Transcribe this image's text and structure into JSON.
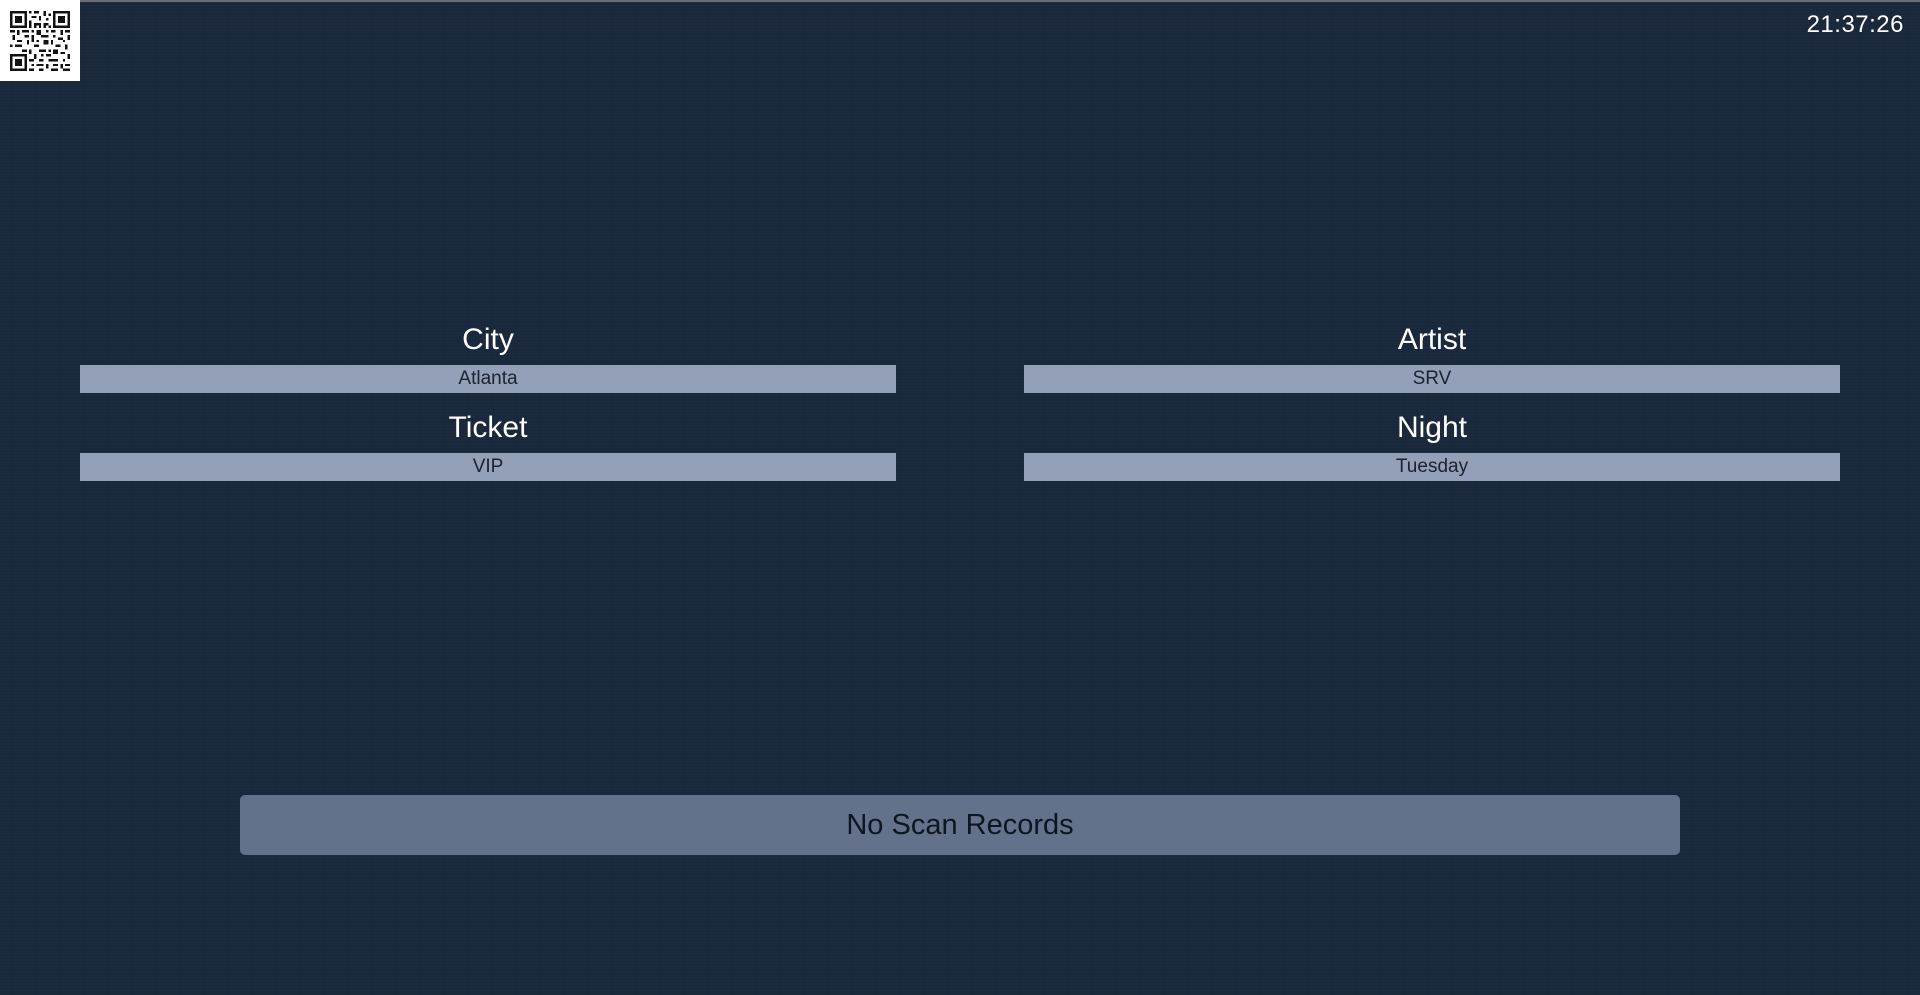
{
  "clock": "21:37:26",
  "icons": {
    "qr": "qr-code-icon"
  },
  "colors": {
    "background": "#1b2a3e",
    "field_bar": "#94a0b7",
    "scan_bar": "#64718a"
  },
  "fields": {
    "city": {
      "label": "City",
      "value": "Atlanta"
    },
    "artist": {
      "label": "Artist",
      "value": "SRV"
    },
    "ticket": {
      "label": "Ticket",
      "value": "VIP"
    },
    "night": {
      "label": "Night",
      "value": "Tuesday"
    }
  },
  "scan_records": "No Scan Records"
}
